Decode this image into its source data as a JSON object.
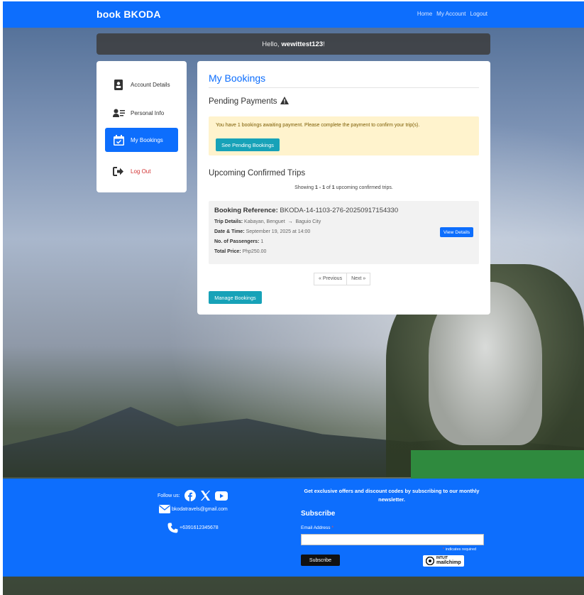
{
  "navbar": {
    "brand": "book BKODA",
    "links": [
      "Home",
      "My Account",
      "Logout"
    ]
  },
  "greeting": {
    "prefix": "Hello,",
    "username": "wewittest123",
    "suffix": "!"
  },
  "sidebar": {
    "items": [
      {
        "label": "Account Details",
        "icon": "contact-card-icon"
      },
      {
        "label": "Personal Info",
        "icon": "user-list-icon"
      },
      {
        "label": "My Bookings",
        "icon": "calendar-check-icon"
      },
      {
        "label": "Log Out",
        "icon": "sign-out-icon"
      }
    ]
  },
  "main": {
    "title": "My Bookings",
    "pending": {
      "title": "Pending Payments",
      "alert_text": "You have 1 bookings awaiting payment. Please complete the payment to confirm your trip(s).",
      "button": "See Pending Bookings"
    },
    "upcoming": {
      "title": "Upcoming Confirmed Trips",
      "showing_prefix": "Showing",
      "range_start": "1",
      "range_end": "1",
      "of": "of",
      "total": "1",
      "showing_suffix": "upcoming confirmed trips."
    },
    "booking": {
      "ref_label": "Booking Reference:",
      "ref_value": "BKODA-14-1103-276-20250917154330",
      "trip_label": "Trip Details:",
      "trip_from": "Kabayan, Benguet",
      "trip_to": "Baguio City",
      "date_label": "Date & Time:",
      "date_value": "September 19, 2025 at 14:00",
      "pax_label": "No. of Passengers:",
      "pax_value": "1",
      "price_label": "Total Price:",
      "price_value": "Php250.00",
      "view_button": "View Details"
    },
    "pager": {
      "prev": "« Previous",
      "next": "Next »"
    },
    "manage_button": "Manage Bookings"
  },
  "footer": {
    "follow_label": "Follow us:",
    "email": "bkodatravels@gmail.com",
    "phone": "+6391612345678",
    "offer_text": "Get exclusive offers and discount codes by subscribing to our monthly newsletter.",
    "subscribe_title": "Subscribe",
    "email_label": "Email Address",
    "required_star": "*",
    "required_note": "indicates required",
    "subscribe_button": "Subscribe",
    "mailchimp_top": "INTUIT",
    "mailchimp_bottom": "mailchimp"
  },
  "colors": {
    "primary": "#0d6efd",
    "teal": "#17a2b8",
    "alert_bg": "#fff3cd",
    "logout": "#d23333"
  }
}
